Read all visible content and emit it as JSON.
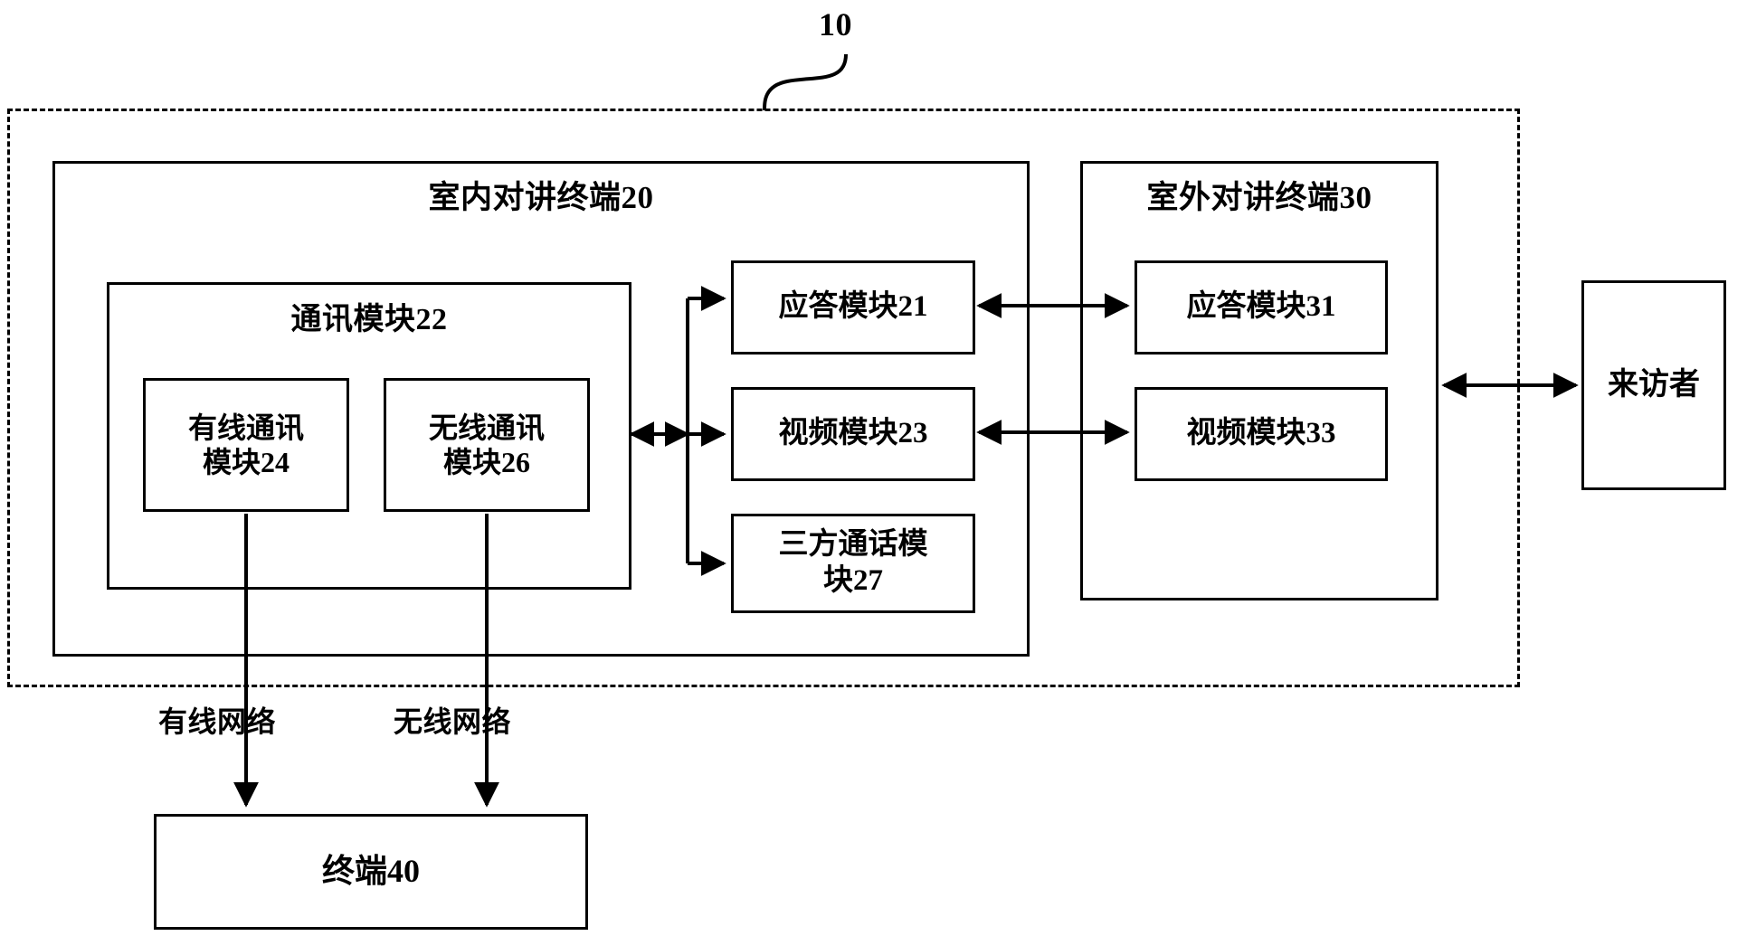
{
  "diagram": {
    "system_ref": "10",
    "indoor_terminal": {
      "title": "室内对讲终端20",
      "comm_module": {
        "title": "通讯模块22",
        "submodules": [
          {
            "label": "有线通讯\n模块24",
            "line1": "有线通讯",
            "line2": "模块24"
          },
          {
            "label": "无线通讯\n模块26",
            "line1": "无线通讯",
            "line2": "模块26"
          }
        ]
      },
      "modules": [
        {
          "label": "应答模块21"
        },
        {
          "label": "视频模块23"
        },
        {
          "label": "三方通话模\n块27",
          "line1": "三方通话模",
          "line2": "块27"
        }
      ]
    },
    "outdoor_terminal": {
      "title": "室外对讲终端30",
      "modules": [
        {
          "label": "应答模块31"
        },
        {
          "label": "视频模块33"
        }
      ]
    },
    "visitor": {
      "label": "来访者"
    },
    "terminal": {
      "label": "终端40"
    },
    "network_links": [
      {
        "label": "有线网络"
      },
      {
        "label": "无线网络"
      }
    ]
  },
  "colors": {
    "stroke": "#000000",
    "background": "#ffffff"
  }
}
